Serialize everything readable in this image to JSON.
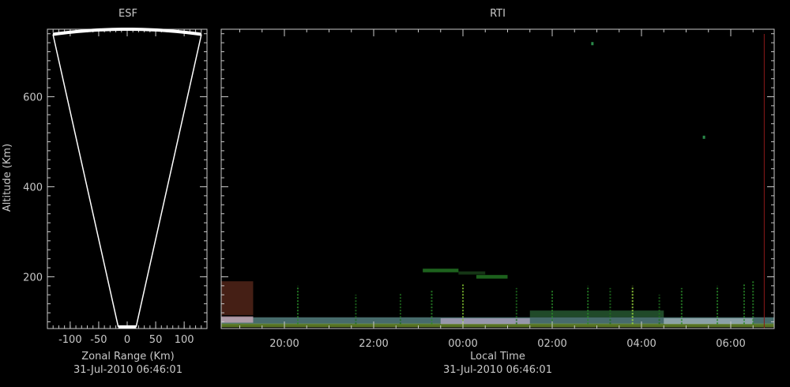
{
  "theme": {
    "background": "#000000",
    "axis_color": "#c8c8c8",
    "fan_color": "#ffffff"
  },
  "chart_data": [
    {
      "type": "scatter",
      "title": "ESF",
      "xlabel": "Zonal Range (Km)",
      "ylabel": "Altitude (Km)",
      "date_label": "31-Jul-2010 06:46:01",
      "xlim": [
        -140,
        140
      ],
      "ylim": [
        85,
        750
      ],
      "xticks": [
        {
          "value": -100,
          "label": "-100"
        },
        {
          "value": -50,
          "label": "-50"
        },
        {
          "value": 0,
          "label": "0"
        },
        {
          "value": 50,
          "label": "50"
        },
        {
          "value": 100,
          "label": "100"
        }
      ],
      "yticks": [
        {
          "value": 200,
          "label": "200"
        },
        {
          "value": 400,
          "label": "400"
        },
        {
          "value": 600,
          "label": "600"
        }
      ],
      "coverage": {
        "inner_range_km": 90,
        "outer_range_km": 750,
        "half_angle_deg": 10
      }
    },
    {
      "type": "heatmap",
      "title": "RTI",
      "xlabel": "Local Time",
      "date_label": "31-Jul-2010 06:46:01",
      "xlim": [
        18.3,
        6.9
      ],
      "ylim": [
        85,
        750
      ],
      "xticks": [
        {
          "value": 20,
          "label": "20:00"
        },
        {
          "value": 22,
          "label": "22:00"
        },
        {
          "value": 24,
          "label": "00:00"
        },
        {
          "value": 26,
          "label": "02:00"
        },
        {
          "value": 28,
          "label": "04:00"
        },
        {
          "value": 30,
          "label": "06:00"
        }
      ],
      "yticks": [
        {
          "value": 200,
          "label": "200"
        },
        {
          "value": 400,
          "label": "400"
        },
        {
          "value": 600,
          "label": "600"
        }
      ],
      "current_time_marker": {
        "value": 30.75,
        "color": "#8a1a1a"
      },
      "echo_bands": [
        {
          "t0": 18.3,
          "t1": 31.0,
          "alt0": 95,
          "alt1": 110,
          "color": "#5f8f8f",
          "opacity": 0.75
        },
        {
          "t0": 18.3,
          "t1": 31.0,
          "alt0": 88,
          "alt1": 96,
          "color": "#9fcf3f",
          "opacity": 0.55
        },
        {
          "t0": 18.3,
          "t1": 19.3,
          "alt0": 98,
          "alt1": 112,
          "color": "#c8a8b8",
          "opacity": 0.8
        },
        {
          "t0": 23.5,
          "t1": 25.5,
          "alt0": 95,
          "alt1": 108,
          "color": "#b8a8c8",
          "opacity": 0.7
        },
        {
          "t0": 28.5,
          "t1": 30.5,
          "alt0": 95,
          "alt1": 108,
          "color": "#a8b8c0",
          "opacity": 0.7
        },
        {
          "t0": 25.5,
          "t1": 28.5,
          "alt0": 110,
          "alt1": 125,
          "color": "#2e6a3a",
          "opacity": 0.7
        },
        {
          "t0": 18.4,
          "t1": 19.3,
          "alt0": 115,
          "alt1": 190,
          "color": "#6a3020",
          "opacity": 0.65
        },
        {
          "t0": 23.1,
          "t1": 23.9,
          "alt0": 210,
          "alt1": 218,
          "color": "#2a8a2a",
          "opacity": 0.7
        },
        {
          "t0": 23.9,
          "t1": 24.5,
          "alt0": 205,
          "alt1": 212,
          "color": "#2a6a2a",
          "opacity": 0.5
        },
        {
          "t0": 24.3,
          "t1": 25.0,
          "alt0": 196,
          "alt1": 204,
          "color": "#2a8a2a",
          "opacity": 0.7
        }
      ],
      "plumes": [
        {
          "t": 20.3,
          "alt_top": 180,
          "color": "#2a8a2a"
        },
        {
          "t": 21.6,
          "alt_top": 160,
          "color": "#1f6f1f"
        },
        {
          "t": 22.6,
          "alt_top": 165,
          "color": "#1f6f1f"
        },
        {
          "t": 23.3,
          "alt_top": 170,
          "color": "#2a8a2a"
        },
        {
          "t": 24.0,
          "alt_top": 185,
          "color": "#7fbf2f"
        },
        {
          "t": 25.2,
          "alt_top": 175,
          "color": "#1f6f1f"
        },
        {
          "t": 26.0,
          "alt_top": 170,
          "color": "#2a8a2a"
        },
        {
          "t": 26.8,
          "alt_top": 180,
          "color": "#2a8a2a"
        },
        {
          "t": 27.3,
          "alt_top": 175,
          "color": "#1f6f1f"
        },
        {
          "t": 27.8,
          "alt_top": 180,
          "color": "#9fdf3f"
        },
        {
          "t": 28.4,
          "alt_top": 160,
          "color": "#1f6f1f"
        },
        {
          "t": 28.9,
          "alt_top": 175,
          "color": "#2a8a2a"
        },
        {
          "t": 29.7,
          "alt_top": 180,
          "color": "#2a8a2a"
        },
        {
          "t": 30.3,
          "alt_top": 185,
          "color": "#2a8a2a"
        },
        {
          "t": 30.5,
          "alt_top": 190,
          "color": "#2a8a2a"
        }
      ],
      "dots": [
        {
          "t": 26.9,
          "alt": 718,
          "color": "#2a8a4a"
        },
        {
          "t": 29.4,
          "alt": 510,
          "color": "#2a8a4a"
        }
      ]
    }
  ]
}
